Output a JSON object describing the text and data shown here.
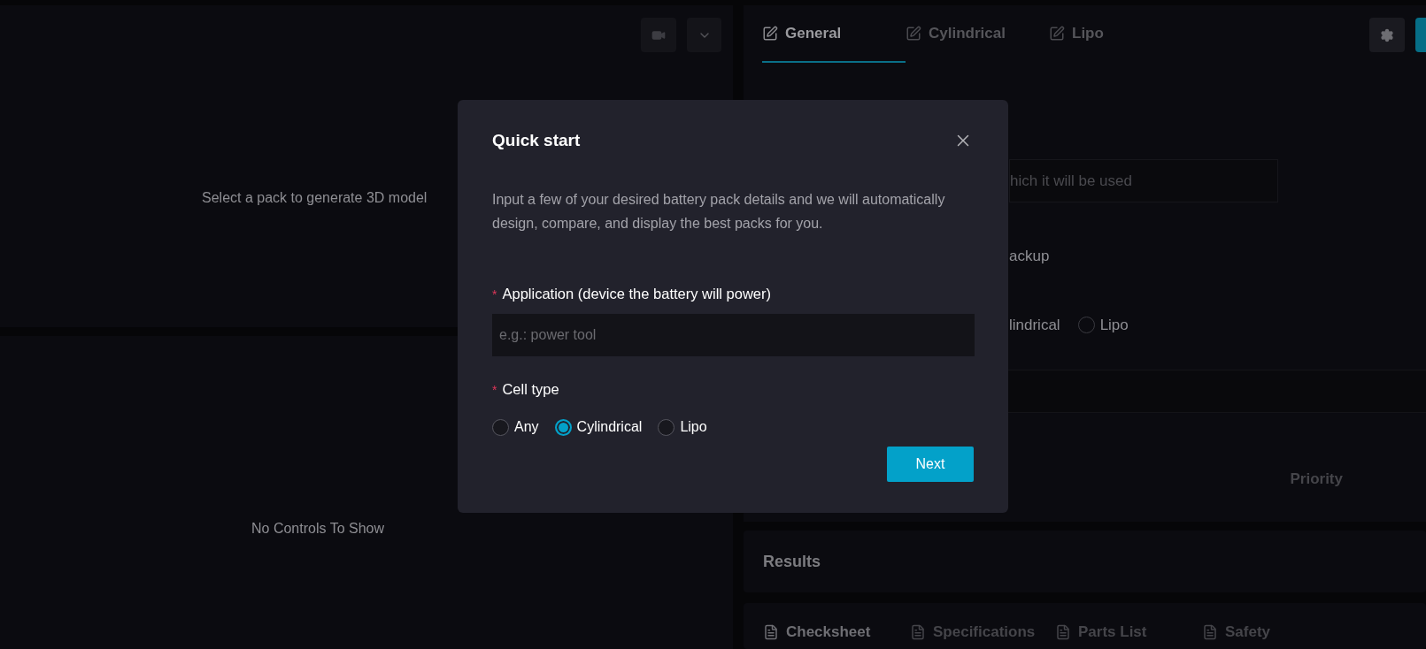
{
  "viewer": {
    "message": "Select a pack to generate 3D model"
  },
  "controls_panel": {
    "message": "No Controls To Show"
  },
  "tabs": [
    {
      "label": "General",
      "selected": true
    },
    {
      "label": "Cylindrical",
      "selected": false
    },
    {
      "label": "Lipo",
      "selected": false
    }
  ],
  "form_background": {
    "field_placeholder": "hich it will be used",
    "option_label": "ackup",
    "option_text": "lindrical",
    "radio": {
      "label": "Lipo",
      "selected": false
    },
    "priority_header": "Priority"
  },
  "results": {
    "title": "Results"
  },
  "result_tabs": [
    {
      "label": "Checksheet",
      "selected": true
    },
    {
      "label": "Specifications",
      "selected": false
    },
    {
      "label": "Parts List",
      "selected": false
    },
    {
      "label": "Safety",
      "selected": false
    }
  ],
  "dialog": {
    "title": "Quick start",
    "description": "Input a few of your desired battery pack details and we will automatically design, compare, and display the best packs for you.",
    "application_label": "Application (device the battery will power)",
    "application_required_mark": "*",
    "application_placeholder": "e.g.: power tool",
    "cell_type_label": "Cell type",
    "cell_type_required_mark": "*",
    "cell_types": [
      {
        "label": "Any",
        "selected": false
      },
      {
        "label": "Cylindrical",
        "selected": true
      },
      {
        "label": "Lipo",
        "selected": false
      }
    ],
    "next_button": "Next"
  }
}
